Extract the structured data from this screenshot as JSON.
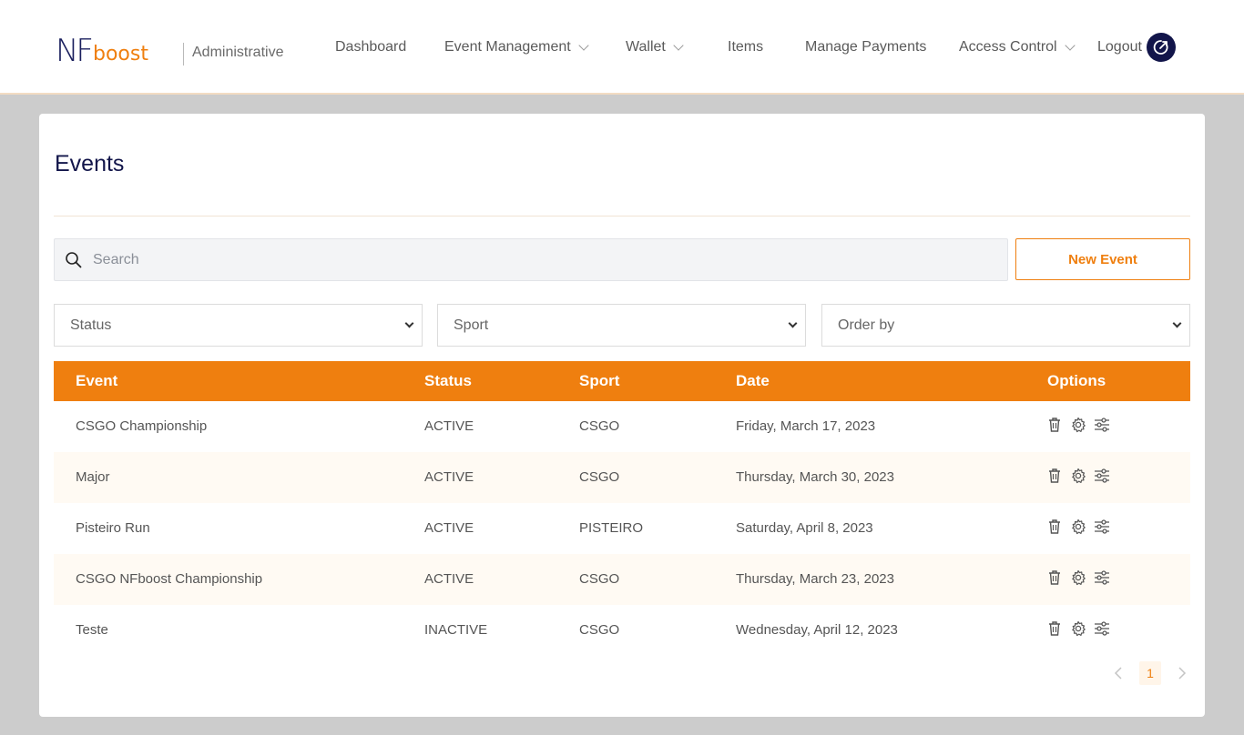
{
  "header": {
    "logo_nf": "NF",
    "logo_boost": "boost",
    "admin_label": "Administrative",
    "nav": [
      {
        "label": "Dashboard",
        "dropdown": false
      },
      {
        "label": "Event Management",
        "dropdown": true
      },
      {
        "label": "Wallet",
        "dropdown": true
      },
      {
        "label": "Items",
        "dropdown": false
      },
      {
        "label": "Manage Payments",
        "dropdown": false
      },
      {
        "label": "Access Control",
        "dropdown": true
      },
      {
        "label": "Logout",
        "dropdown": false
      }
    ]
  },
  "page": {
    "title": "Events"
  },
  "search": {
    "placeholder": "Search",
    "value": ""
  },
  "new_event_label": "New Event",
  "filters": {
    "status": "Status",
    "sport": "Sport",
    "order_by": "Order by"
  },
  "table": {
    "columns": [
      "Event",
      "Status",
      "Sport",
      "Date",
      "Options"
    ],
    "rows": [
      {
        "event": "CSGO Championship",
        "status": "ACTIVE",
        "sport": "CSGO",
        "date": "Friday, March 17, 2023"
      },
      {
        "event": "Major",
        "status": "ACTIVE",
        "sport": "CSGO",
        "date": "Thursday, March 30, 2023"
      },
      {
        "event": "Pisteiro Run",
        "status": "ACTIVE",
        "sport": "PISTEIRO",
        "date": "Saturday, April 8, 2023"
      },
      {
        "event": "CSGO NFboost Championship",
        "status": "ACTIVE",
        "sport": "CSGO",
        "date": "Thursday, March 23, 2023"
      },
      {
        "event": "Teste",
        "status": "INACTIVE",
        "sport": "CSGO",
        "date": "Wednesday, April 12, 2023"
      }
    ],
    "option_icons": [
      "trash-icon",
      "gear-icon",
      "sliders-icon"
    ]
  },
  "pagination": {
    "current_page": "1"
  },
  "colors": {
    "accent": "#ef7f0f",
    "brand_dark": "#12154a",
    "background": "#cccccc",
    "alt_row": "#fffaf3"
  }
}
